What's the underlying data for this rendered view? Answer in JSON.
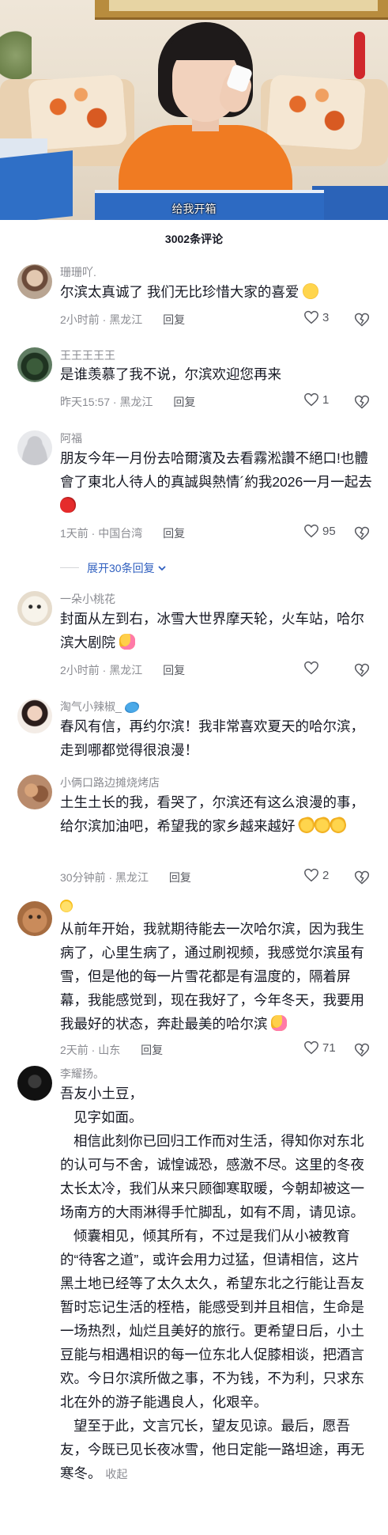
{
  "video": {
    "subtitle": "给我开箱"
  },
  "comments_header": {
    "count_text": "3002条评论"
  },
  "comments": [
    {
      "username": "珊珊吖.",
      "text": "尔滨太真诚了 我们无比珍惜大家的喜爱",
      "emoji": "pleading-face",
      "time": "2小时前 · 黑龙江",
      "reply": "回复",
      "likes": "3"
    },
    {
      "username": "王王王王王",
      "text": "是谁羡慕了我不说，尔滨欢迎您再来",
      "time": "昨天15:57 · 黑龙江",
      "reply": "回复",
      "likes": "1"
    },
    {
      "username": "阿福",
      "text": "朋友今年一月份去哈爾濱及去看霧淞讚不絕口!也體會了東北人待人的真誠與熱情´約我2026一月一起去",
      "emoji": "apple",
      "time": "1天前 · 中国台湾",
      "reply": "回复",
      "likes": "95"
    },
    {
      "username": "一朵小桃花",
      "text": "封面从左到右，冰雪大世界摩天轮，火车站，哈尔滨大剧院",
      "emoji": "hug",
      "time": "2小时前 · 黑龙江",
      "reply": "回复",
      "likes": ""
    },
    {
      "username": "淘气小辣椒_",
      "text": "春风有信，再约尔滨！我非常喜欢夏天的哈尔滨，走到哪都觉得很浪漫！",
      "emoji": "dolphin"
    },
    {
      "username": "小俩口路边摊烧烤店",
      "text": "土生土长的我，看哭了，尔滨还有这么浪漫的事，给尔滨加油吧，希望我的家乡越来越好",
      "emoji": "clap",
      "time": "30分钟前 · 黑龙江",
      "reply": "回复",
      "likes": "2"
    },
    {
      "username": "",
      "text": "从前年开始，我就期待能去一次哈尔滨，因为我生病了，心里生病了，通过刷视频，我感觉尔滨虽有雪，但是他的每一片雪花都是有温度的，隔着屏幕，我能感觉到，现在我好了，今年冬天，我要用我最好的状态，奔赴最美的哈尔滨",
      "emoji": "hug",
      "time": "2天前 · 山东",
      "reply": "回复",
      "likes": "71"
    },
    {
      "username": "李耀扬。",
      "paragraphs": [
        "吾友小土豆，",
        "见字如面。",
        "相信此刻你已回归工作而对生活，得知你对东北的认可与不舍，诚惶诚恐，感激不尽。这里的冬夜太长太冷，我们从来只顾御寒取暖，今朝却被这一场南方的大雨淋得手忙脚乱，如有不周，请见谅。",
        "倾囊相见，倾其所有，不过是我们从小被教育的“待客之道”，或许会用力过猛，但请相信，这片黑土地已经等了太久太久，希望东北之行能让吾友暂时忘记生活的桎梏，能感受到并且相信，生命是一场热烈，灿烂且美好的旅行。更希望日后，小土豆能与相遇相识的每一位东北人促膝相谈，把酒言欢。今日尔滨所做之事，不为钱，不为利，只求东北在外的游子能遇良人，化艰辛。",
        "望至于此，文言冗长，望友见谅。最后，愿吾友，今既已见长夜冰雪，他日定能一路坦途，再无寒冬。"
      ],
      "collapse": "收起"
    }
  ],
  "expand_replies": "展开30条回复"
}
